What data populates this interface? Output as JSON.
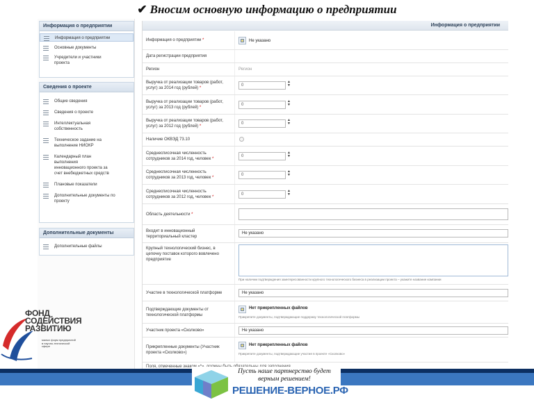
{
  "slide_title": "Вносим основную информацию о предприятии",
  "left_panels": [
    {
      "title": "Информация о предприятии",
      "items": [
        {
          "label": "Информация о предприятии"
        },
        {
          "label": "Основные документы"
        },
        {
          "label": "Учредители и участники проекта"
        }
      ]
    },
    {
      "title": "Сведения о проекте",
      "items": [
        {
          "label": "Общие сведения"
        },
        {
          "label": "Сведения о проекте"
        },
        {
          "label": "Интеллектуальная собственность"
        },
        {
          "label": "Техническое задание на выполнение НИОКР"
        },
        {
          "label": "Календарный план выполнения инновационного проекта за счет внебюджетных средств"
        },
        {
          "label": "Плановые показатели"
        },
        {
          "label": "Дополнительные документы по проекту"
        }
      ]
    },
    {
      "title": "Дополнительные документы",
      "items": [
        {
          "label": "Дополнительные файлы"
        }
      ]
    }
  ],
  "form": {
    "header": "Информация о предприятии",
    "rows": {
      "company_info": {
        "label": "Информация о предприятии",
        "required": "*",
        "value": "Не указано"
      },
      "reg_date": {
        "label": "Дата регистрации предприятия"
      },
      "region": {
        "label": "Регион",
        "value": "Регион"
      },
      "revenue_2014": {
        "label": "Выручка от реализации товаров (работ, услуг) за 2014 год (рублей)",
        "required": "*",
        "value": "0"
      },
      "revenue_2013": {
        "label": "Выручка от реализации товаров (работ, услуг) за 2013 год (рублей)",
        "required": "*",
        "value": "0"
      },
      "revenue_2012": {
        "label": "Выручка от реализации товаров (работ, услуг) за 2012 год (рублей)",
        "required": "*",
        "value": "0"
      },
      "okved": {
        "label": "Наличие ОКВЭД 73.10"
      },
      "staff_2014": {
        "label": "Среднесписочная численность сотрудников за 2014 год, человек",
        "required": "*",
        "value": "0"
      },
      "staff_2013": {
        "label": "Среднесписочная численность сотрудников за 2013 год, человек",
        "required": "*",
        "value": "0"
      },
      "staff_2012": {
        "label": "Среднесписочная численность сотрудников за 2012 год, человек",
        "required": "*",
        "value": "0"
      },
      "activity": {
        "label": "Область деятельности",
        "required": "*"
      },
      "cluster": {
        "label": "Входит в инновационный территориальный кластер",
        "value": "Не указано"
      },
      "big_business": {
        "label": "Крупный технологический бизнес, в цепочку поставок которого вовлечено предприятие",
        "hint": "При наличии подтверждения заинтересованности крупного технологического бизнеса в реализации проекта – укажите название компании"
      },
      "tech_platform": {
        "label": "Участие в технологической платформе",
        "value": "Не указано"
      },
      "platform_docs": {
        "label": "Подтверждающие документы от технологической платформы",
        "value": "Нет прикрепленных файлов",
        "hint": "Прикрепите документы, подтверждающие поддержку технологической платформы"
      },
      "skolkovo": {
        "label": "Участник проекта «Сколково»",
        "value": "Не указано"
      },
      "skolkovo_docs": {
        "label": "Прикрепленные документы (Участник проекта «Сколково»)",
        "value": "Нет прикрепленных файлов",
        "hint": "Прикрепите документы, подтверждающие участие в проекте «Сколково»"
      }
    },
    "footer_note": "Поля, отмеченные знаком «*», должны быть обязательны для заполнения"
  },
  "logo": {
    "line1": "ФОНД",
    "line2": "СОДЕЙСТВИЯ",
    "line3": "РАЗВИТИЮ",
    "sub": "малых форм предприятий в научно-технической сфере",
    "colors": {
      "red": "#d52b2b",
      "blue": "#1f4f9c"
    }
  },
  "banner": {
    "slogan": "Пусть наше партнерство будет верным решением!",
    "brand": "РЕШЕНИЕ-ВЕРНОЕ.РФ"
  },
  "colors": {
    "band_dark": "#0c2f62",
    "band_blue": "#3b77c0",
    "brand_blue": "#2a64b2"
  }
}
